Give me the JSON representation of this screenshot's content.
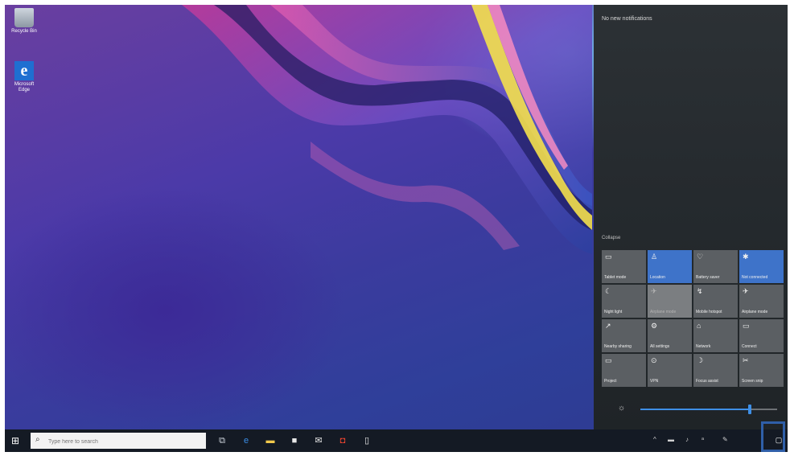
{
  "desktop": {
    "icons": [
      {
        "label": "Recycle Bin",
        "icon": "recycle-bin-icon"
      },
      {
        "label": "Microsoft Edge",
        "icon": "edge-icon"
      }
    ]
  },
  "action_center": {
    "notifications_text": "No new notifications",
    "collapse_label": "Collapse",
    "tiles": [
      {
        "label": "Tablet mode",
        "icon": "tablet-mode-icon",
        "state": "off"
      },
      {
        "label": "Location",
        "icon": "location-icon",
        "state": "on"
      },
      {
        "label": "Battery saver",
        "icon": "battery-saver-icon",
        "state": "off"
      },
      {
        "label": "Not connected",
        "icon": "bluetooth-icon",
        "state": "on"
      },
      {
        "label": "Night light",
        "icon": "night-light-icon",
        "state": "off"
      },
      {
        "label": "Airplane mode",
        "icon": "airplane-icon",
        "state": "dim"
      },
      {
        "label": "Mobile hotspot",
        "icon": "mobile-hotspot-icon",
        "state": "off"
      },
      {
        "label": "Airplane mode",
        "icon": "airplane-mode-icon",
        "state": "off"
      },
      {
        "label": "Nearby sharing",
        "icon": "nearby-sharing-icon",
        "state": "off"
      },
      {
        "label": "All settings",
        "icon": "settings-icon",
        "state": "off"
      },
      {
        "label": "Network",
        "icon": "network-icon",
        "state": "off"
      },
      {
        "label": "Connect",
        "icon": "connect-icon",
        "state": "off"
      },
      {
        "label": "Project",
        "icon": "project-icon",
        "state": "off"
      },
      {
        "label": "VPN",
        "icon": "vpn-icon",
        "state": "off"
      },
      {
        "label": "Focus assist",
        "icon": "focus-assist-icon",
        "state": "off"
      },
      {
        "label": "Screen snip",
        "icon": "screen-snip-icon",
        "state": "off"
      }
    ],
    "brightness_level": 0.8
  },
  "taskbar": {
    "search_placeholder": "Type here to search",
    "apps": [
      {
        "name": "task-view",
        "icon": "task-view-icon",
        "glyph": "⧉",
        "color": "#cfd6de"
      },
      {
        "name": "edge",
        "icon": "edge-icon",
        "glyph": "e",
        "color": "#3a8ee6"
      },
      {
        "name": "file-explorer",
        "icon": "folder-icon",
        "glyph": "▬",
        "color": "#f2c94c"
      },
      {
        "name": "store",
        "icon": "store-icon",
        "glyph": "■",
        "color": "#e8e8e8"
      },
      {
        "name": "mail",
        "icon": "mail-icon",
        "glyph": "✉",
        "color": "#e8e8e8"
      },
      {
        "name": "samsung-app",
        "icon": "app-icon",
        "glyph": "◘",
        "color": "#e8442f"
      },
      {
        "name": "tablet-app",
        "icon": "tablet-app-icon",
        "glyph": "▯",
        "color": "#e8e8e8"
      }
    ],
    "tray_icons": [
      "chevron-up-icon",
      "battery-icon",
      "wifi-icon",
      "language-icon",
      "pen-icon"
    ],
    "notification_icon": "notification-icon"
  },
  "colors": {
    "accent": "#3e73c9",
    "taskbar": "#141a24",
    "highlight": "#2f5fa8"
  }
}
